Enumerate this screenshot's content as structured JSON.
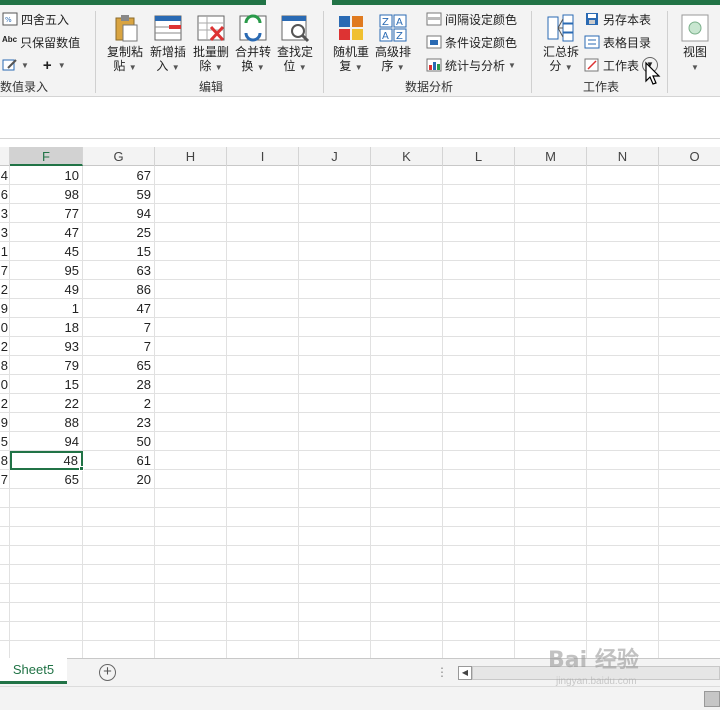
{
  "ribbon": {
    "group1": {
      "round_label": "四舍五入",
      "keep_value_label": "只保留数值",
      "label": "数值录入",
      "abc_icon_text": "Abc",
      "plus_text": "+"
    },
    "group2": {
      "label": "编辑",
      "buttons": [
        {
          "line1": "复制粘",
          "line2": "贴"
        },
        {
          "line1": "新增插",
          "line2": "入"
        },
        {
          "line1": "批量删",
          "line2": "除"
        },
        {
          "line1": "合并转",
          "line2": "换"
        },
        {
          "line1": "查找定",
          "line2": "位"
        }
      ]
    },
    "group3": {
      "label": "数据分析",
      "buttons": [
        {
          "line1": "随机重",
          "line2": "复"
        },
        {
          "line1": "高级排",
          "line2": "序"
        }
      ],
      "interval_color_label": "间隔设定颜色",
      "condition_color_label": "条件设定颜色",
      "stats_label": "统计与分析"
    },
    "group4": {
      "label": "工作表",
      "summary_line1": "汇总拆",
      "summary_line2": "分",
      "save_as_label": "另存本表",
      "toc_label": "表格目录",
      "sheet_label": "工作表"
    },
    "group5": {
      "view_label": "视图"
    }
  },
  "columns": [
    {
      "id": "E",
      "label": ""
    },
    {
      "id": "F",
      "label": "F"
    },
    {
      "id": "G",
      "label": "G"
    },
    {
      "id": "H",
      "label": "H"
    },
    {
      "id": "I",
      "label": "I"
    },
    {
      "id": "J",
      "label": "J"
    },
    {
      "id": "K",
      "label": "K"
    },
    {
      "id": "L",
      "label": "L"
    },
    {
      "id": "M",
      "label": "M"
    },
    {
      "id": "N",
      "label": "N"
    },
    {
      "id": "O",
      "label": "O"
    }
  ],
  "rows": [
    {
      "e": "4",
      "f": "10",
      "g": "67"
    },
    {
      "e": "6",
      "f": "98",
      "g": "59"
    },
    {
      "e": "3",
      "f": "77",
      "g": "94"
    },
    {
      "e": "3",
      "f": "47",
      "g": "25"
    },
    {
      "e": "1",
      "f": "45",
      "g": "15"
    },
    {
      "e": "7",
      "f": "95",
      "g": "63"
    },
    {
      "e": "2",
      "f": "49",
      "g": "86"
    },
    {
      "e": "9",
      "f": "1",
      "g": "47"
    },
    {
      "e": "0",
      "f": "18",
      "g": "7"
    },
    {
      "e": "2",
      "f": "93",
      "g": "7"
    },
    {
      "e": "8",
      "f": "79",
      "g": "65"
    },
    {
      "e": "0",
      "f": "15",
      "g": "28"
    },
    {
      "e": "2",
      "f": "22",
      "g": "2"
    },
    {
      "e": "9",
      "f": "88",
      "g": "23"
    },
    {
      "e": "5",
      "f": "94",
      "g": "50"
    },
    {
      "e": "8",
      "f": "48",
      "g": "61"
    },
    {
      "e": "7",
      "f": "65",
      "g": "20"
    }
  ],
  "active_cell": {
    "row": 15,
    "col": "f"
  },
  "sheet_tab": {
    "label": "Sheet5"
  },
  "add_sheet_symbol": "+",
  "tab_dots": "⋮",
  "watermark": {
    "text": "Bai 经验",
    "sub": "jingyan.baidu.com"
  },
  "colors": {
    "accent": "#217346",
    "ribbon_bg": "#f3f3f3",
    "grid_line": "#e1e1e1"
  }
}
